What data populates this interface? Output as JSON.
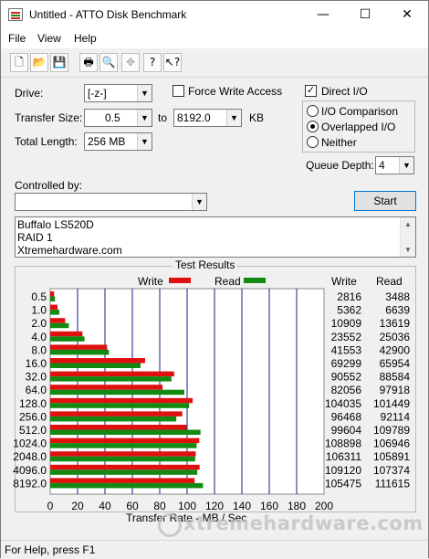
{
  "window": {
    "title": "Untitled - ATTO Disk Benchmark",
    "minimize": "—",
    "maximize": "☐",
    "close": "✕"
  },
  "menu": [
    "File",
    "View",
    "Help"
  ],
  "toolbar": {
    "buttons": [
      "new-icon",
      "open-icon",
      "save-icon",
      "print-icon",
      "print-preview-icon",
      "move-icon",
      "help-icon",
      "context-help-icon"
    ]
  },
  "settings": {
    "drive_label": "Drive:",
    "drive_value": "[-z-]",
    "transfer_size_label": "Transfer Size:",
    "transfer_from": "0.5",
    "to_label": "to",
    "transfer_to": "8192.0",
    "unit": "KB",
    "total_length_label": "Total Length:",
    "total_length_value": "256 MB",
    "force_write_access": "Force Write Access",
    "direct_io": "Direct I/O",
    "io_comparison": "I/O Comparison",
    "overlapped_io": "Overlapped I/O",
    "neither": "Neither",
    "queue_depth_label": "Queue Depth:",
    "queue_depth_value": "4",
    "controlled_by_label": "Controlled by:",
    "controlled_by_value": "",
    "start_label": "Start"
  },
  "description": [
    "Buffalo LS520D",
    "RAID 1",
    "Xtremehardware.com"
  ],
  "results": {
    "title": "Test Results",
    "write_legend": "Write",
    "read_legend": "Read",
    "write_col": "Write",
    "read_col": "Read",
    "xlabel": "Transfer Rate - MB / Sec",
    "write_color": "#e01010",
    "read_color": "#128a12"
  },
  "chart_data": {
    "type": "bar",
    "orientation": "horizontal",
    "categories": [
      "0.5",
      "1.0",
      "2.0",
      "4.0",
      "8.0",
      "16.0",
      "32.0",
      "64.0",
      "128.0",
      "256.0",
      "512.0",
      "1024.0",
      "2048.0",
      "4096.0",
      "8192.0"
    ],
    "series": [
      {
        "name": "Write",
        "values": [
          2816,
          5362,
          10909,
          23552,
          41553,
          69299,
          90552,
          82056,
          104035,
          96468,
          99604,
          108898,
          106311,
          109120,
          105475
        ]
      },
      {
        "name": "Read",
        "values": [
          3488,
          6639,
          13619,
          25036,
          42900,
          65954,
          88584,
          97918,
          101449,
          92114,
          109789,
          106946,
          105891,
          107374,
          111615
        ]
      }
    ],
    "xlabel": "Transfer Rate - MB / Sec",
    "xlim": [
      0,
      200
    ],
    "xticks": [
      "0",
      "20",
      "40",
      "60",
      "80",
      "100",
      "120",
      "140",
      "160",
      "180",
      "200"
    ],
    "units_note": "table values in KB/s; bars in MB/s",
    "grid": true,
    "legend": "top"
  },
  "status": {
    "text": "For Help, press F1"
  },
  "watermark": "xtremehardware.com"
}
